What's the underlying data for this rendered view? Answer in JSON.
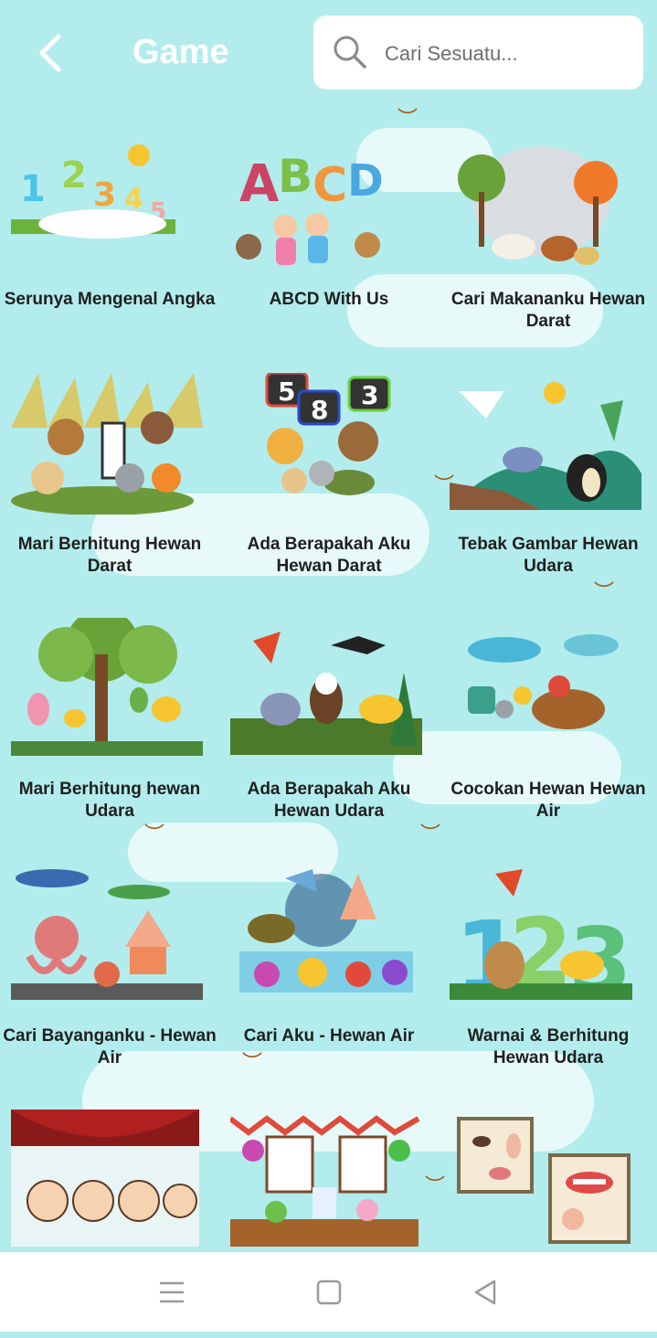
{
  "header": {
    "title": "Game",
    "search_placeholder": "Cari Sesuatu..."
  },
  "games": [
    {
      "label": "Serunya Mengenal Angka",
      "art": "numbers"
    },
    {
      "label": "ABCD With Us",
      "art": "abcd"
    },
    {
      "label": "Cari Makananku Hewan Darat",
      "art": "farm"
    },
    {
      "label": "Mari Berhitung Hewan Darat",
      "art": "land-animals"
    },
    {
      "label": "Ada Berapakah Aku Hewan Darat",
      "art": "counting-land"
    },
    {
      "label": "Tebak Gambar Hewan Udara",
      "art": "birds"
    },
    {
      "label": "Mari Berhitung hewan Udara",
      "art": "tree-birds"
    },
    {
      "label": "Ada Berapakah Aku Hewan Udara",
      "art": "flying"
    },
    {
      "label": "Cocokan Hewan Hewan Air",
      "art": "sea"
    },
    {
      "label": "Cari Bayanganku - Hewan Air",
      "art": "octopus"
    },
    {
      "label": "Cari Aku - Hewan Air",
      "art": "reef"
    },
    {
      "label": "Warnai & Berhitung Hewan Udara",
      "art": "color-count"
    },
    {
      "label": "",
      "art": "hands"
    },
    {
      "label": "",
      "art": "food"
    },
    {
      "label": "",
      "art": "body"
    }
  ],
  "nav": {
    "menu_icon": "menu-icon",
    "home_icon": "square-icon",
    "back_icon": "triangle-back-icon"
  },
  "colors": {
    "background": "#b3ecec",
    "title": "#ffffff",
    "label": "#1f1f1f"
  }
}
